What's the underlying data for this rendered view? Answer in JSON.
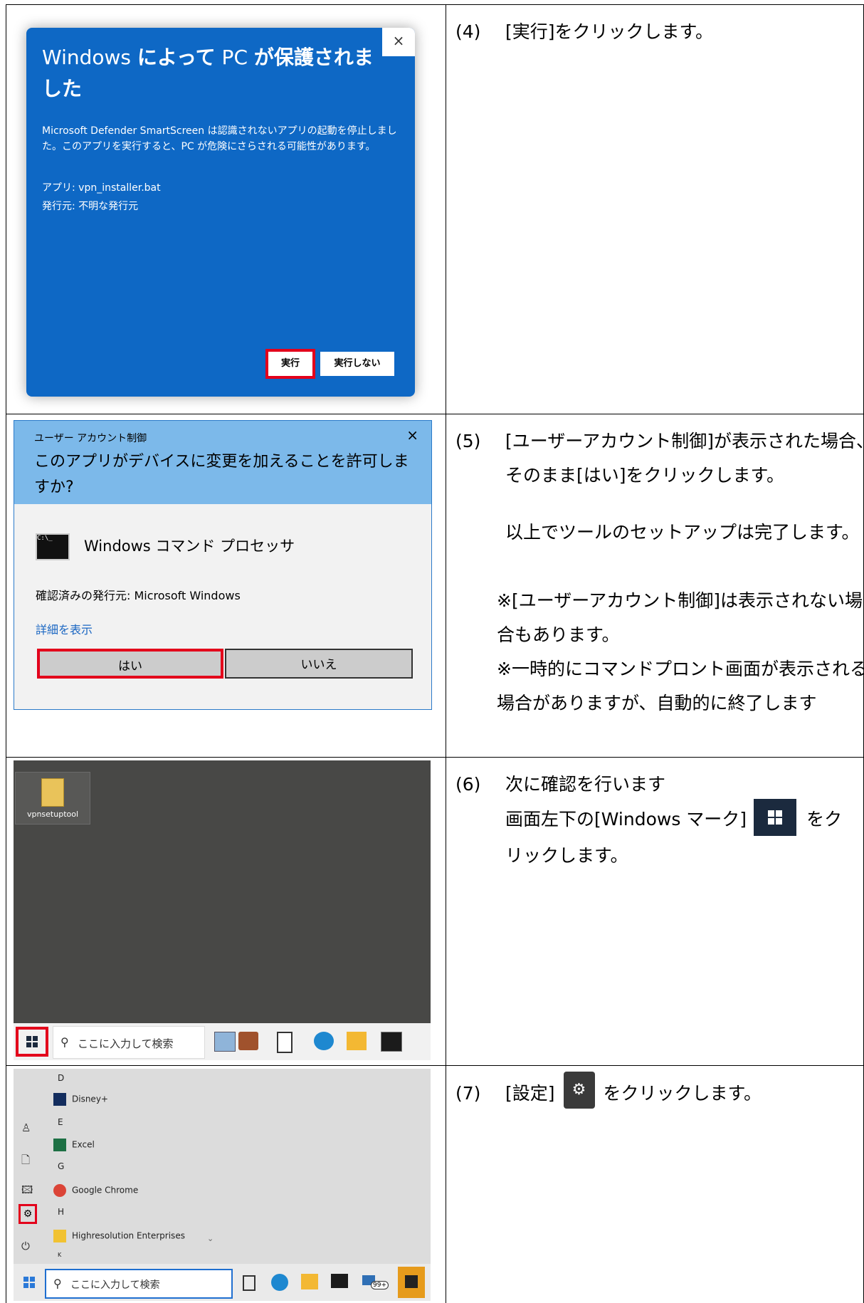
{
  "rows": [
    {
      "num": "(4)",
      "lines": [
        "[実行]をクリックします。"
      ],
      "screen": {
        "close": "×",
        "title_a": "Windows ",
        "title_b": "によって",
        "title_c": " PC ",
        "title_d": "が保護されました",
        "message": "Microsoft Defender SmartScreen は認識されないアプリの起動を停止しました。このアプリを実行すると、PC が危険にさらされる可能性があります。",
        "app": "アプリ: vpn_installer.bat",
        "publisher": "発行元: 不明な発行元",
        "run": "実行",
        "dont_run": "実行しない"
      }
    },
    {
      "num": "(5)",
      "line1": "[ユーザーアカウント制御]が表示された場合、",
      "line2": "そのまま[はい]をクリックします。",
      "line3": "以上でツールのセットアップは完了します。",
      "note1a": "※[ユーザーアカウント制御]は表示されない場",
      "note1b": "合もあります。",
      "note2a": "※一時的にコマンドプロント画面が表示される",
      "note2b": "場合がありますが、自動的に終了します",
      "screen": {
        "header": "ユーザー アカウント制御",
        "close": "×",
        "question": "このアプリがデバイスに変更を加えることを許可しますか?",
        "cmd_icon": "C:\\_",
        "app": "Windows コマンド プロセッサ",
        "verified": "確認済みの発行元: Microsoft Windows",
        "details": "詳細を表示",
        "yes": "はい",
        "no": "いいえ"
      }
    },
    {
      "num": "(6)",
      "line1": "次に確認を行います",
      "line2a": "画面左下の[Windows マーク]",
      "line2b": "をク",
      "line3": "リックします。",
      "screen": {
        "folder": "vpnsetuptool",
        "search_icon": "⚲",
        "search": "ここに入力して検索"
      }
    },
    {
      "num": "(7)",
      "line_a": "[設定]",
      "line_b": "をクリックします。",
      "gear_glyph": "⚙",
      "screen": {
        "letters": [
          "D",
          "E",
          "G",
          "H",
          "K"
        ],
        "apps": [
          "Disney+",
          "Excel",
          "Google Chrome",
          "Highresolution Enterprises"
        ],
        "rail_icons": [
          "user-icon",
          "document-icon",
          "pictures-icon",
          "settings-gear-icon",
          "power-icon"
        ],
        "rail_glyphs": [
          "♙",
          "🗋",
          "🖾",
          "⚙",
          "⏻"
        ],
        "chevron": "⌄",
        "search_icon": "⚲",
        "search": "ここに入力して検索",
        "badge": "99+"
      }
    }
  ]
}
